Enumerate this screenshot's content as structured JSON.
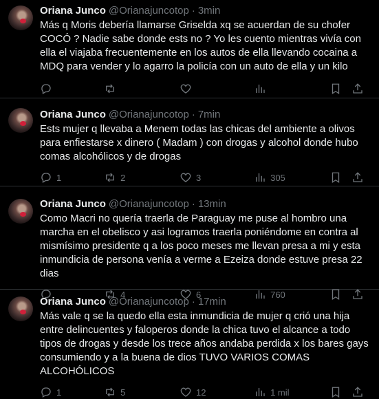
{
  "tweets": [
    {
      "name": "Oriana Junco",
      "handle": "@Orianajuncotop",
      "time": "3min",
      "text": "Más q Moris debería llamarse Griselda xq se acuerdan de su chofer COCÓ ? Nadie sabe donde ests no ? Yo les cuento mientras vivía con ella el viajaba frecuentemente en los autos de ella llevando cocaina a MDQ para vender y lo agarro la policía con un auto de ella y un kilo",
      "replies": "",
      "retweets": "",
      "likes": "",
      "views": ""
    },
    {
      "name": "Oriana Junco",
      "handle": "@Orianajuncotop",
      "time": "7min",
      "text": "Ests mujer q llevaba  a Menem todas las chicas del ambiente a olivos para enfiestarse x dinero ( Madam ) con drogas y alcohol donde hubo comas alcohólicos y de drogas",
      "replies": "1",
      "retweets": "2",
      "likes": "3",
      "views": "305"
    },
    {
      "name": "Oriana Junco",
      "handle": "@Orianajuncotop",
      "time": "13min",
      "text": "Como Macri no quería traerla de Paraguay me puse al hombro una marcha en el obelisco y asi logramos traerla poniéndome en contra al mismísimo presidente q a los poco meses me llevan presa a mi y esta inmundicia de persona venía a verme a Ezeiza donde estuve presa 22 dias",
      "replies": "",
      "retweets": "4",
      "likes": "6",
      "views": "760"
    },
    {
      "name": "Oriana Junco",
      "handle": "@Orianajuncotop",
      "time": "17min",
      "text": "Más vale q se la quedo ella esta inmundicia de mujer q crió una hija entre delincuentes y faloperos  donde la chica tuvo el alcance a todo tipos de drogas y desde los trece años andaba perdida x los bares gays consumiendo y a la buena de dios TUVO VARIOS COMAS ALCOHÓLICOS",
      "replies": "1",
      "retweets": "5",
      "likes": "12",
      "views": "1 mil"
    }
  ]
}
